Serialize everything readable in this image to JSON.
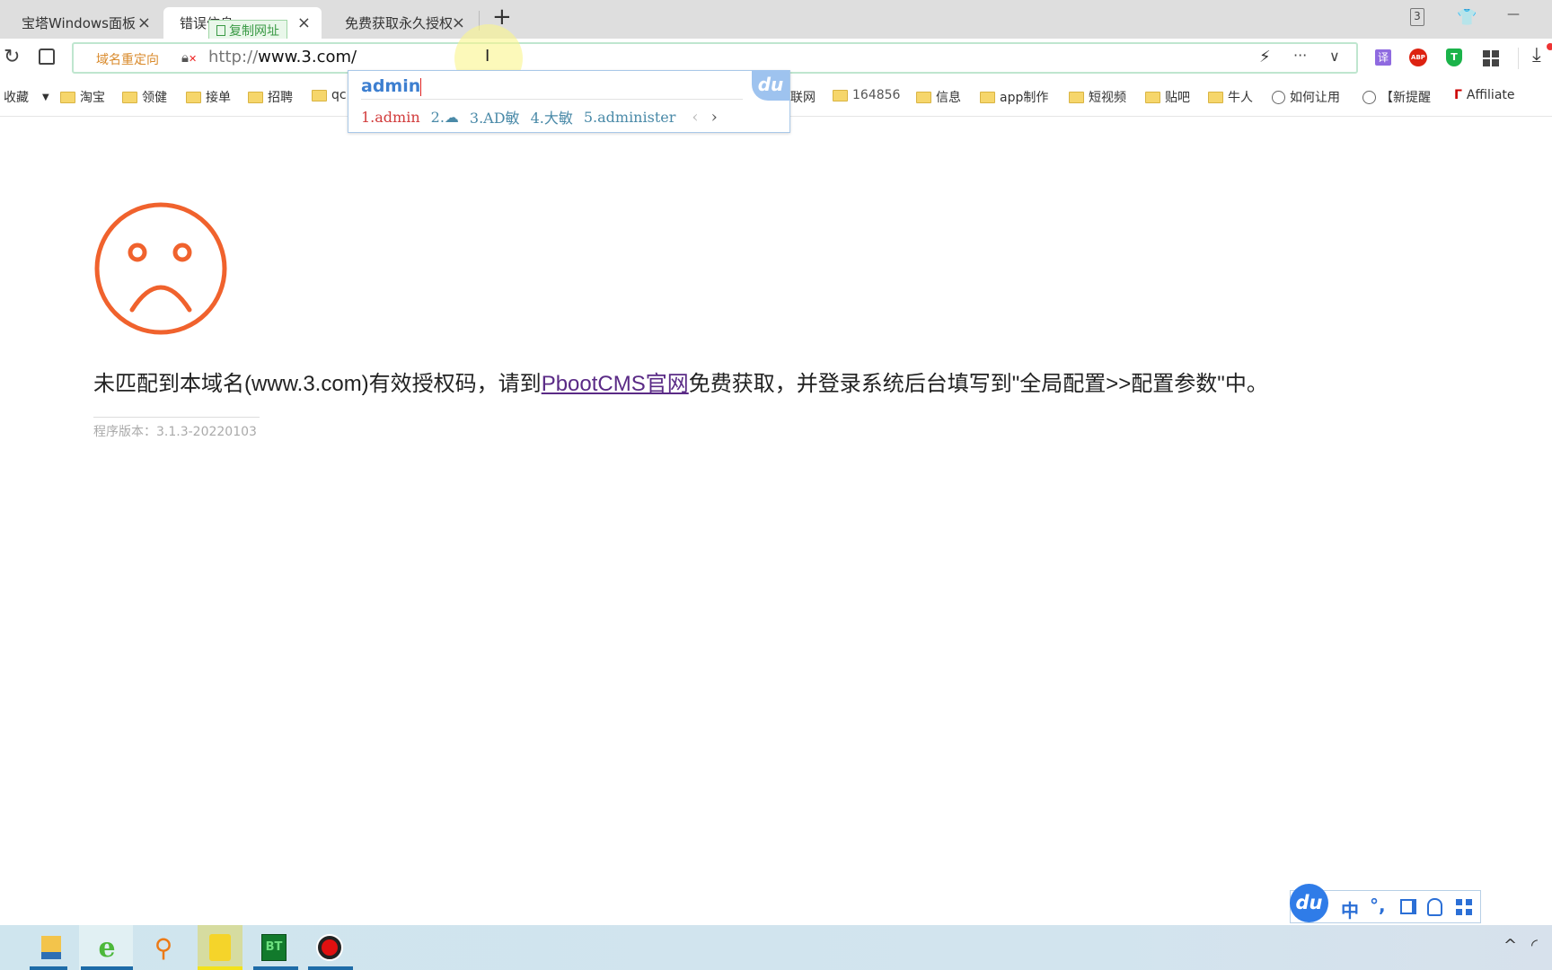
{
  "tabs": [
    {
      "label": "宝塔Windows面板",
      "close": "×"
    },
    {
      "label": "错误信息",
      "close": "×",
      "active": true
    },
    {
      "label": "免费获取永久授权",
      "close": "×"
    }
  ],
  "new_tab": "+",
  "copy_url_tooltip": "复制网址",
  "window_badge": "3",
  "window_minimize": "—",
  "address": {
    "redirect_label": "域名重定向",
    "url_prefix": "http://",
    "url_host": "www.3.com/",
    "more": "···",
    "dropdown": "∨"
  },
  "extensions": {
    "translate": "译",
    "abp": "ABP",
    "shield": "T"
  },
  "bookmarks": {
    "favorites": "收藏",
    "items": [
      "淘宝",
      "领健",
      "接单",
      "招聘",
      "qc",
      "联网",
      "164856",
      "信息",
      "app制作",
      "短视频",
      "贴吧",
      "牛人"
    ],
    "links": [
      "如何让用",
      "【新提醒",
      "Affiliate"
    ]
  },
  "ime_suggest": {
    "input": "admin",
    "logo": "du",
    "candidates": [
      "1.admin",
      "2.",
      "3.AD敏",
      "4.大敏",
      "5.administer"
    ],
    "prev": "‹",
    "next": "›"
  },
  "page": {
    "message_before": "未匹配到本域名(www.3.com)有效授权码，请到",
    "link_text": "PbootCMS官网",
    "message_after": "免费获取，并登录系统后台填写到\"全局配置>>配置参数\"中。",
    "version": "程序版本：3.1.3-20220103",
    "accent_color": "#f0622d"
  },
  "ime_toolbar": {
    "logo": "du",
    "mode": "中",
    "punct": "°,"
  },
  "taskbar": {
    "bt_label": "BT"
  }
}
